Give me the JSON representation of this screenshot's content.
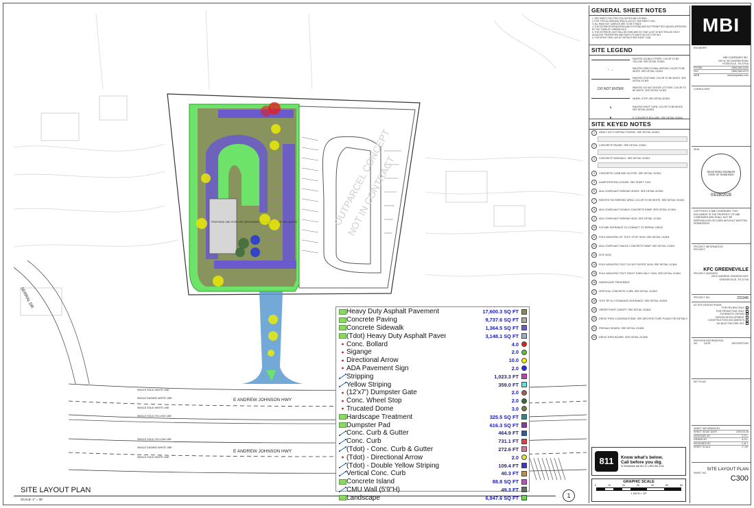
{
  "drawing": {
    "title": "SITE LAYOUT PLAN",
    "scale": "SCALE: 1\" = 30'",
    "sheet_callout": "1",
    "road_upper": "E ANDREW JOHNSON HWY",
    "road_lower": "E ANDREW JOHNSON HWY",
    "side_road": "SERRAL DR",
    "outparcel_line1": "OUTPARCEL CONCEPT",
    "outparcel_line2": "NOT IN CONTRACT",
    "building_label": "PROPOSED ONE STORY KFC RESTAURANT BUILDING 2,675 SF FFE=1548.05",
    "line_labels": [
      "SINGLE SOLID WHITE LINE",
      "SINGLE DASHED WHITE LINE",
      "SINGLE SOLID WHITE LINE",
      "SINGLE SOLID YELLOW LINE",
      "SINGLE SOLID YELLOW LINE",
      "SINGLE DASHED WHITE LINE",
      "SINGLE SOLID WHITE LINE"
    ],
    "graphic_scale_title": "GRAPHIC SCALE",
    "graphic_scale_ticks": [
      "0",
      "10",
      "20",
      "30",
      "40",
      "50",
      "60"
    ],
    "graphic_scale_unit": "1 INCH = 30'",
    "callout_811_line1": "Know what's below.",
    "callout_811_line2": "Call before you dig.",
    "callout_811_line3": "In Tennessee call 811 or 1-800-351-1111",
    "callout_811_logo": "811"
  },
  "ledger": {
    "rows": [
      {
        "name": "Heavy Duty Asphalt Pavement",
        "value": "17,600.3 SQ FT",
        "icon": "area",
        "color": "#8c8a5c",
        "shape": "square"
      },
      {
        "name": "Concrete Paving",
        "value": "9,737.6 SQ FT",
        "icon": "area",
        "color": "#a8a8a8",
        "shape": "square"
      },
      {
        "name": "Concrete Sidewalk",
        "value": "1,364.5 SQ FT",
        "icon": "area",
        "color": "#6a5acd",
        "shape": "square"
      },
      {
        "name": "(Tdot) Heavy Duty Asphalt Pavement",
        "value": "3,148.1 SQ FT",
        "icon": "area",
        "color": "#9ab0c8",
        "shape": "square"
      },
      {
        "name": "Conc. Bollard",
        "value": "4.0",
        "icon": "count",
        "color": "#e02020",
        "shape": "round"
      },
      {
        "name": "Sigange",
        "value": "2.0",
        "icon": "count",
        "color": "#60c040",
        "shape": "round"
      },
      {
        "name": "Directional Arrow",
        "value": "10.0",
        "icon": "count",
        "color": "#f0f000",
        "shape": "round"
      },
      {
        "name": "ADA Pavement Sign",
        "value": "2.0",
        "icon": "count",
        "color": "#2030e0",
        "shape": "round"
      },
      {
        "name": "Stripping",
        "value": "1,023.3 FT",
        "icon": "length",
        "color": "#c040c0",
        "shape": "square"
      },
      {
        "name": "Yellow Striping",
        "value": "359.0 FT",
        "icon": "length",
        "color": "#60e0e0",
        "shape": "square"
      },
      {
        "name": "(12'x7') Dumpster Gate",
        "value": "2.0",
        "icon": "count",
        "color": "#a06060",
        "shape": "round"
      },
      {
        "name": "Conc. Wheel Stop",
        "value": "2.0",
        "icon": "count",
        "color": "#3a6a3a",
        "shape": "round"
      },
      {
        "name": "Trucated Dome",
        "value": "3.0",
        "icon": "count",
        "color": "#7a7a40",
        "shape": "round"
      },
      {
        "name": "Hardscape Treatment",
        "value": "325.5 SQ FT",
        "icon": "area",
        "color": "#2a8a8a",
        "shape": "square"
      },
      {
        "name": "Dumpster Pad",
        "value": "616.3 SQ FT",
        "icon": "area",
        "color": "#8a3a9a",
        "shape": "square"
      },
      {
        "name": "Conc. Curb & Gutter",
        "value": "464.9 FT",
        "icon": "length",
        "color": "#2a5aa0",
        "shape": "square"
      },
      {
        "name": "Conc. Curb",
        "value": "731.1 FT",
        "icon": "length",
        "color": "#e04040",
        "shape": "square"
      },
      {
        "name": "(Tdot) - Conc. Curb & Gutter",
        "value": "272.6 FT",
        "icon": "length",
        "color": "#e070a0",
        "shape": "square"
      },
      {
        "name": "(Tdot) - Directional Arrow",
        "value": "2.0",
        "icon": "count",
        "color": "#e0e040",
        "shape": "round"
      },
      {
        "name": "(Tdot) - Double Yellow Striping",
        "value": "109.4 FT",
        "icon": "length",
        "color": "#3a3ac0",
        "shape": "square"
      },
      {
        "name": "Vertical Conc. Curb",
        "value": "40.3 FT",
        "icon": "length",
        "color": "#c09040",
        "shape": "square"
      },
      {
        "name": "Concrete Island",
        "value": "88.8 SQ FT",
        "icon": "area",
        "color": "#c050c0",
        "shape": "square"
      },
      {
        "name": "CMU Wall (5'9\"H)",
        "value": "49.3 FT",
        "icon": "length",
        "color": "#607060",
        "shape": "square"
      },
      {
        "name": "Landscape",
        "value": "6,947.6 SQ FT",
        "icon": "area",
        "color": "#60e040",
        "shape": "square"
      }
    ]
  },
  "general_notes": {
    "title": "GENERAL SHEET NOTES",
    "items": [
      "1. SEE SHEET C001 FOR CIVIL NOTES AND LEGEND.",
      "2. FOR TYPICAL PARKING SPACE LAYOUT, SEE SHEET C001.",
      "3. ALL RADII NOT LABELED ARE TO BE 5' RADII.",
      "4. THE EXTERIOR SPEAKER/SOUND SYSTEMS ARE NOT PERMITTED UNLESS APPROVED BY THE TOWN OF GREENEVILLE.",
      "5. THE EXTERIOR LIGHT WILL BE SHIELDED SO THAT LIGHT IS NOT SPILLED ONTO ADJACENT PROPERTIES AND RIGHT-OF-WAYS OR INTO THE SKY.",
      "6. FOR DRIVE-THRU LAYOUT DETAILS SEE SHEET C300."
    ]
  },
  "site_legend": {
    "title": "SITE LEGEND",
    "items": [
      {
        "symbol": "",
        "text": "PAINTED DOUBLE STRIPE, COLOR TO BE YELLOW. SEE DETAIL 9/C801"
      },
      {
        "symbol": "↑ →",
        "text": "PAINTED DIRECTIONAL ARROW, COLOR TO BE WHITE. SEE DETAIL 1/C803"
      },
      {
        "symbol": "",
        "text": "PAINTED STOP BAR, COLOR TO BE WHITE. SEE DETAIL 2/C803"
      },
      {
        "symbol": "DO NOT ENTER",
        "text": "PAINTED 'DO NOT ENTER' LETTERS. COLOR TO BE WHITE. SEE DETAIL 7/C802"
      },
      {
        "symbol": "",
        "text": "WHEEL STOP. SEE DETAIL 8/C801"
      },
      {
        "symbol": "↰",
        "text": "PAINTED RIGHT TURN, COLOR TO BE WHITE. SEE DETAIL 8/C803"
      },
      {
        "symbol": "●",
        "text": "6\" CONCRETE BOLLARD. SEE DETAIL 3/C804"
      }
    ]
  },
  "keyed_notes": {
    "title": "SITE KEYED NOTES",
    "items": [
      {
        "num": "1",
        "text": "HEAVY DUTY ASPHALT PAVING. SEE DETAIL 3/C801",
        "detail": true
      },
      {
        "num": "2",
        "text": "CONCRETE PAVING. SEE DETAIL 2/C801",
        "detail": true
      },
      {
        "num": "3",
        "text": "CONCRETE SIDEWALK. SEE DETAIL 4/C801",
        "detail": true
      },
      {
        "num": "4",
        "text": "CONCRETE CURB AND GUTTER. SEE DETAIL 3/C801",
        "detail": false
      },
      {
        "num": "5",
        "text": "DUMPSTER ENCLOSURE. SEE SHEET C300",
        "detail": false
      },
      {
        "num": "6",
        "text": "ADA COMPLIANT PARKING SPACE. SEE DETAIL 9/C801",
        "detail": false
      },
      {
        "num": "7",
        "text": "PAINTED 'NO PARKING' AREA, COLOR TO BE WHITE. SEE DETAIL 9/C801",
        "detail": false
      },
      {
        "num": "8",
        "text": "ADA COMPLIANT DOUBLE CONCRETE RAMP. SEE DETAIL 1/C804",
        "detail": false
      },
      {
        "num": "9",
        "text": "ADA COMPLIANT PARKING SIGN. SEE DETAIL 1/C801",
        "detail": false
      },
      {
        "num": "10",
        "text": "FUTURE ENTRANCE TO CONNECT TO SERRAL DRIVE",
        "detail": false
      },
      {
        "num": "11",
        "text": "POLE MOUNTED 30\" TDOT 'STOP' SIGN. SEE DETAIL 1/C804",
        "detail": false
      },
      {
        "num": "12",
        "text": "ADA COMPLIANT SINGLE CONCRETE RAMP. SEE DETAIL 1/C804",
        "detail": false
      },
      {
        "num": "13",
        "text": "SITE SIGN",
        "detail": false
      },
      {
        "num": "14",
        "text": "POLE MOUNTED TDOT 'DO NOT ENTER' SIGN. SEE DETAIL 1/C804",
        "detail": false
      },
      {
        "num": "15",
        "text": "POLE MOUNTED TDOT 'RIGHT TURN ONLY' SIGN. SEE DETAIL 1/C804",
        "detail": false
      },
      {
        "num": "16",
        "text": "HARDSCAPE TREATMENT",
        "detail": false
      },
      {
        "num": "17",
        "text": "VERTICAL CONCRETE CURB. SEE DETAIL 1/C803",
        "detail": false
      },
      {
        "num": "18",
        "text": "TDOT RP-M-1 STANDARD ENTRANCE. SEE DETAIL 4/C804",
        "detail": false
      },
      {
        "num": "19",
        "text": "ORDER POINT CANOPY. SEE DETAIL 4/C804",
        "detail": false
      },
      {
        "num": "20",
        "text": "DRIVE-THRU CLEARANCE BAR. SEE ARCHITECTURE PLANS FOR DETAILS",
        "detail": false
      },
      {
        "num": "21",
        "text": "PRESALE BOARD. SEE DETAIL 2/C806",
        "detail": false
      },
      {
        "num": "22",
        "text": "DRIVE-THRU BOARD. SEE DETAIL 2/C806",
        "detail": false
      }
    ]
  },
  "title_block": {
    "logo": "MBI",
    "engineer_label": "ENGINEER",
    "firm_lines": [
      "MBI COMPANIES INC.",
      "299 W. MCGAVERB ROAD",
      "ROSEVILLE, TN 37918"
    ],
    "contact_rows": [
      {
        "label": "PHONE",
        "value": "(865) 584-0433"
      },
      {
        "label": "FAX",
        "value": "(865) 584-0273"
      },
      {
        "label": "WEB",
        "value": "mbicompanies.com"
      }
    ],
    "consultant_label": "CONSULTANT",
    "seal_label": "SEAL",
    "seal_text": "REGISTERED ENGINEER STATE OF TENNESSEE",
    "seal_date": "03/28/2025",
    "copyright": "COPYRIGHT & MBI COMPANIES. THIS DOCUMENT IS THE PROPERTY OF MBI COMPANIES AND SHALL NOT BE REPRODUCED OR USED WITHOUT WRITTEN PERMISSION.",
    "project_info_label": "PROJECT INFORMATION",
    "project_label": "PROJECT",
    "project_name": "KFC GREENEVILLE",
    "project_address_label": "PROJECT ADDRESS",
    "project_address": "200 E ANDREW JOHNSON HWY GREENEVILLE, TN 37745",
    "project_no_label": "PROJECT NO.",
    "project_no": "231346",
    "active_phase_label": "ACTIVE DESIGN PHASE",
    "phases": [
      "FOR REVIEW ONLY",
      "FOR PERMITTING ONLY",
      "SCHEMATIC DESIGN",
      "DESIGN DEVELOPMENT",
      "CONSTRUCTION DOCUMENTS",
      "AS-BUILT RECORD SET"
    ],
    "revision_label": "REVISION INFORMATION",
    "revision_cols": [
      "NO",
      "DATE",
      "DESCRIPTION"
    ],
    "key_plan_label": "KEY PLAN",
    "sheet_info_label": "SHEET INFORMATION",
    "sheet_rows": [
      {
        "label": "SHEET ISSUE DATE",
        "value": "2025.03.28"
      },
      {
        "label": "DESIGNED BY",
        "value": "A.S.L."
      },
      {
        "label": "DRAWN BY",
        "value": "A.S.L."
      },
      {
        "label": "REVIEWED BY",
        "value": "C.B.T."
      },
      {
        "label": "SHEET SCALE",
        "value": "1\"=30'"
      }
    ],
    "sheet_title": "SITE LAYOUT PLAN",
    "sheet_number_label": "SHEET NO.",
    "sheet_number": "C300"
  }
}
